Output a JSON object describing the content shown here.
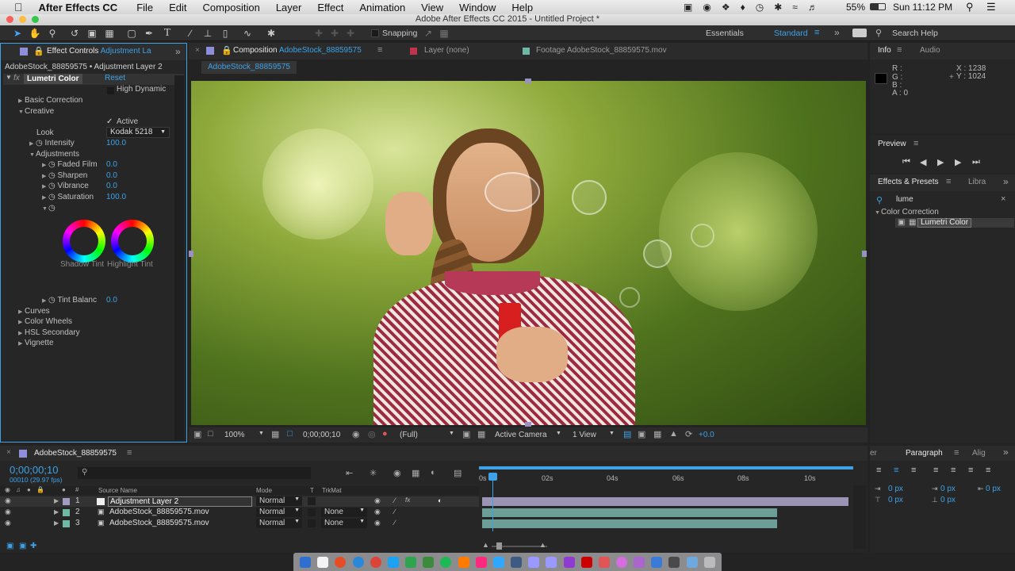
{
  "menubar": {
    "app": "After Effects CC",
    "items": [
      "File",
      "Edit",
      "Composition",
      "Layer",
      "Effect",
      "Animation",
      "View",
      "Window",
      "Help"
    ],
    "battery": "55%",
    "clock": "Sun 11:12 PM"
  },
  "window": {
    "title": "Adobe After Effects CC 2015 - Untitled Project *"
  },
  "toolbar": {
    "snapping": "Snapping",
    "workspace_essentials": "Essentials",
    "workspace_standard": "Standard",
    "search_help": "Search Help"
  },
  "effect_controls": {
    "tab_label": "Effect Controls",
    "tab_target": "Adjustment La",
    "breadcrumb": "AdobeStock_88859575 • Adjustment Layer 2",
    "effect_name": "Lumetri Color",
    "reset": "Reset",
    "high_dynamic": "High Dynamic",
    "basic_correction": "Basic Correction",
    "creative": "Creative",
    "active": "Active",
    "look_label": "Look",
    "look_value": "Kodak 5218",
    "intensity_label": "Intensity",
    "intensity_value": "100.0",
    "adjustments": "Adjustments",
    "faded_film_label": "Faded Film",
    "faded_film_value": "0.0",
    "sharpen_label": "Sharpen",
    "sharpen_value": "0.0",
    "vibrance_label": "Vibrance",
    "vibrance_value": "0.0",
    "saturation_label": "Saturation",
    "saturation_value": "100.0",
    "shadow_tint": "Shadow Tint",
    "highlight_tint": "Highlight Tint",
    "tint_balance_label": "Tint Balanc",
    "tint_balance_value": "0.0",
    "curves": "Curves",
    "color_wheels": "Color Wheels",
    "hsl_secondary": "HSL Secondary",
    "vignette": "Vignette"
  },
  "composition": {
    "tab_label": "Composition",
    "tab_name": "AdobeStock_88859575",
    "layer_tab": "Layer (none)",
    "footage_tab": "Footage AdobeStock_88859575.mov",
    "subtab": "AdobeStock_88859575",
    "zoom": "100%",
    "timecode": "0;00;00;10",
    "resolution": "(Full)",
    "camera": "Active Camera",
    "views": "1 View",
    "exposure": "+0.0"
  },
  "info": {
    "tab_info": "Info",
    "tab_audio": "Audio",
    "r": "R :",
    "g": "G :",
    "b": "B :",
    "a": "A : 0",
    "x": "X : 1238",
    "y": "Y : 1024"
  },
  "preview": {
    "title": "Preview"
  },
  "effects_presets": {
    "tab": "Effects & Presets",
    "tab2": "Libra",
    "search_value": "lume",
    "category": "Color Correction",
    "item": "Lumetri Color"
  },
  "paragraph": {
    "tab_left": "er",
    "tab": "Paragraph",
    "tab_right": "Alig",
    "indent1": "0 px",
    "indent2": "0 px",
    "indent3": "0 px",
    "space1": "0 px",
    "space2": "0 px"
  },
  "timeline": {
    "tab": "AdobeStock_88859575",
    "timecode": "0;00;00;10",
    "frames": "00010 (29.97 fps)",
    "col_source": "Source Name",
    "col_mode": "Mode",
    "col_t": "T",
    "col_trkmat": "TrkMat",
    "ruler": [
      "0s",
      "02s",
      "04s",
      "06s",
      "08s",
      "10s"
    ],
    "layers": [
      {
        "num": "1",
        "name": "Adjustment Layer 2",
        "mode": "Normal",
        "trkmat": ""
      },
      {
        "num": "2",
        "name": "AdobeStock_88859575.mov",
        "mode": "Normal",
        "trkmat": "None"
      },
      {
        "num": "3",
        "name": "AdobeStock_88859575.mov",
        "mode": "Normal",
        "trkmat": "None"
      }
    ]
  },
  "colors": {
    "accent": "#3da2e8",
    "adj_bar": "#9c94b4",
    "footage_bar": "#6a9e96"
  }
}
